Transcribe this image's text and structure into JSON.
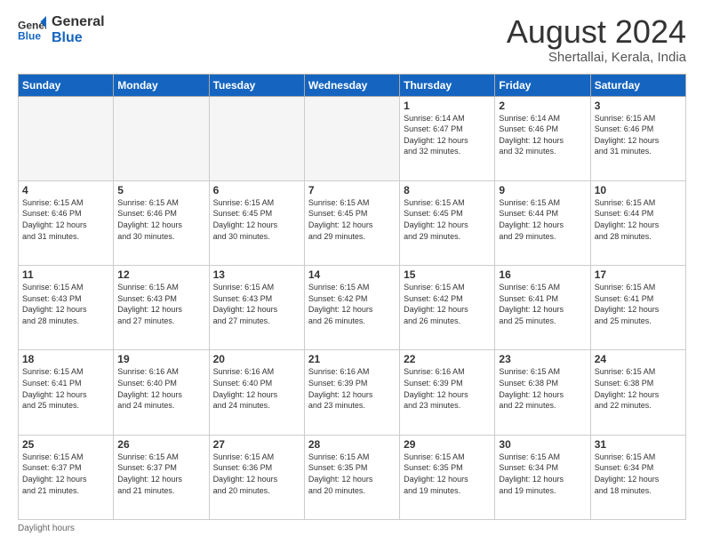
{
  "header": {
    "logo_line1": "General",
    "logo_line2": "Blue",
    "month_title": "August 2024",
    "subtitle": "Shertallai, Kerala, India"
  },
  "weekdays": [
    "Sunday",
    "Monday",
    "Tuesday",
    "Wednesday",
    "Thursday",
    "Friday",
    "Saturday"
  ],
  "footer": "Daylight hours",
  "weeks": [
    [
      {
        "day": "",
        "info": ""
      },
      {
        "day": "",
        "info": ""
      },
      {
        "day": "",
        "info": ""
      },
      {
        "day": "",
        "info": ""
      },
      {
        "day": "1",
        "info": "Sunrise: 6:14 AM\nSunset: 6:47 PM\nDaylight: 12 hours\nand 32 minutes."
      },
      {
        "day": "2",
        "info": "Sunrise: 6:14 AM\nSunset: 6:46 PM\nDaylight: 12 hours\nand 32 minutes."
      },
      {
        "day": "3",
        "info": "Sunrise: 6:15 AM\nSunset: 6:46 PM\nDaylight: 12 hours\nand 31 minutes."
      }
    ],
    [
      {
        "day": "4",
        "info": "Sunrise: 6:15 AM\nSunset: 6:46 PM\nDaylight: 12 hours\nand 31 minutes."
      },
      {
        "day": "5",
        "info": "Sunrise: 6:15 AM\nSunset: 6:46 PM\nDaylight: 12 hours\nand 30 minutes."
      },
      {
        "day": "6",
        "info": "Sunrise: 6:15 AM\nSunset: 6:45 PM\nDaylight: 12 hours\nand 30 minutes."
      },
      {
        "day": "7",
        "info": "Sunrise: 6:15 AM\nSunset: 6:45 PM\nDaylight: 12 hours\nand 29 minutes."
      },
      {
        "day": "8",
        "info": "Sunrise: 6:15 AM\nSunset: 6:45 PM\nDaylight: 12 hours\nand 29 minutes."
      },
      {
        "day": "9",
        "info": "Sunrise: 6:15 AM\nSunset: 6:44 PM\nDaylight: 12 hours\nand 29 minutes."
      },
      {
        "day": "10",
        "info": "Sunrise: 6:15 AM\nSunset: 6:44 PM\nDaylight: 12 hours\nand 28 minutes."
      }
    ],
    [
      {
        "day": "11",
        "info": "Sunrise: 6:15 AM\nSunset: 6:43 PM\nDaylight: 12 hours\nand 28 minutes."
      },
      {
        "day": "12",
        "info": "Sunrise: 6:15 AM\nSunset: 6:43 PM\nDaylight: 12 hours\nand 27 minutes."
      },
      {
        "day": "13",
        "info": "Sunrise: 6:15 AM\nSunset: 6:43 PM\nDaylight: 12 hours\nand 27 minutes."
      },
      {
        "day": "14",
        "info": "Sunrise: 6:15 AM\nSunset: 6:42 PM\nDaylight: 12 hours\nand 26 minutes."
      },
      {
        "day": "15",
        "info": "Sunrise: 6:15 AM\nSunset: 6:42 PM\nDaylight: 12 hours\nand 26 minutes."
      },
      {
        "day": "16",
        "info": "Sunrise: 6:15 AM\nSunset: 6:41 PM\nDaylight: 12 hours\nand 25 minutes."
      },
      {
        "day": "17",
        "info": "Sunrise: 6:15 AM\nSunset: 6:41 PM\nDaylight: 12 hours\nand 25 minutes."
      }
    ],
    [
      {
        "day": "18",
        "info": "Sunrise: 6:15 AM\nSunset: 6:41 PM\nDaylight: 12 hours\nand 25 minutes."
      },
      {
        "day": "19",
        "info": "Sunrise: 6:16 AM\nSunset: 6:40 PM\nDaylight: 12 hours\nand 24 minutes."
      },
      {
        "day": "20",
        "info": "Sunrise: 6:16 AM\nSunset: 6:40 PM\nDaylight: 12 hours\nand 24 minutes."
      },
      {
        "day": "21",
        "info": "Sunrise: 6:16 AM\nSunset: 6:39 PM\nDaylight: 12 hours\nand 23 minutes."
      },
      {
        "day": "22",
        "info": "Sunrise: 6:16 AM\nSunset: 6:39 PM\nDaylight: 12 hours\nand 23 minutes."
      },
      {
        "day": "23",
        "info": "Sunrise: 6:15 AM\nSunset: 6:38 PM\nDaylight: 12 hours\nand 22 minutes."
      },
      {
        "day": "24",
        "info": "Sunrise: 6:15 AM\nSunset: 6:38 PM\nDaylight: 12 hours\nand 22 minutes."
      }
    ],
    [
      {
        "day": "25",
        "info": "Sunrise: 6:15 AM\nSunset: 6:37 PM\nDaylight: 12 hours\nand 21 minutes."
      },
      {
        "day": "26",
        "info": "Sunrise: 6:15 AM\nSunset: 6:37 PM\nDaylight: 12 hours\nand 21 minutes."
      },
      {
        "day": "27",
        "info": "Sunrise: 6:15 AM\nSunset: 6:36 PM\nDaylight: 12 hours\nand 20 minutes."
      },
      {
        "day": "28",
        "info": "Sunrise: 6:15 AM\nSunset: 6:35 PM\nDaylight: 12 hours\nand 20 minutes."
      },
      {
        "day": "29",
        "info": "Sunrise: 6:15 AM\nSunset: 6:35 PM\nDaylight: 12 hours\nand 19 minutes."
      },
      {
        "day": "30",
        "info": "Sunrise: 6:15 AM\nSunset: 6:34 PM\nDaylight: 12 hours\nand 19 minutes."
      },
      {
        "day": "31",
        "info": "Sunrise: 6:15 AM\nSunset: 6:34 PM\nDaylight: 12 hours\nand 18 minutes."
      }
    ]
  ]
}
